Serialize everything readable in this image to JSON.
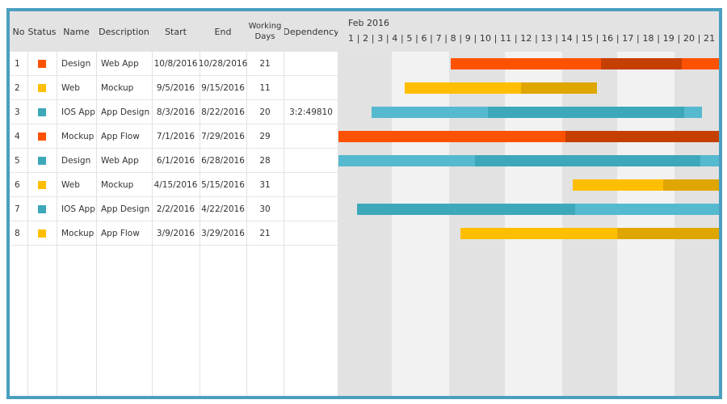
{
  "columns": {
    "no": "No",
    "status": "Status",
    "name": "Name",
    "description": "Description",
    "start": "Start",
    "end": "End",
    "working_days": "Working Days",
    "dependency": "Dependency"
  },
  "timeline": {
    "month": "Feb 2016",
    "days": "1 | 2 | 3 | 4 | 5 | 6 | 7 | 8 | 9 | 10 | 11 | 12 | 13 | 14 | 15 | 16 | 17 | 18 | 19 | 20 | 21"
  },
  "colors": {
    "orange": "#fe5200",
    "orange_dark": "#c53f00",
    "yellow": "#ffbf00",
    "yellow_dark": "#dfa600",
    "teal": "#3da8ba",
    "teal_light": "#55b9cf",
    "band_dark": "#e2e2e2",
    "band_light": "#f2f2f2",
    "frame": "#4a9fbf"
  },
  "rows": [
    {
      "no": "1",
      "status": "orange",
      "name": "Design",
      "description": "Web App",
      "start": "10/8/2016",
      "end": "10/28/2016",
      "working_days": "21",
      "dependency": ""
    },
    {
      "no": "2",
      "status": "yellow",
      "name": "Web",
      "description": "Mockup",
      "start": "9/5/2016",
      "end": "9/15/2016",
      "working_days": "11",
      "dependency": ""
    },
    {
      "no": "3",
      "status": "teal",
      "name": "IOS App",
      "description": "App Design",
      "start": "8/3/2016",
      "end": "8/22/2016",
      "working_days": "20",
      "dependency": "3:2:49810"
    },
    {
      "no": "4",
      "status": "orange",
      "name": "Mockup",
      "description": "App Flow",
      "start": "7/1/2016",
      "end": "7/29/2016",
      "working_days": "29",
      "dependency": ""
    },
    {
      "no": "5",
      "status": "teal",
      "name": "Design",
      "description": "Web App",
      "start": "6/1/2016",
      "end": "6/28/2016",
      "working_days": "28",
      "dependency": ""
    },
    {
      "no": "6",
      "status": "yellow",
      "name": "Web",
      "description": "Mockup",
      "start": "4/15/2016",
      "end": "5/15/2016",
      "working_days": "31",
      "dependency": ""
    },
    {
      "no": "7",
      "status": "teal",
      "name": "IOS App",
      "description": "App Design",
      "start": "2/2/2016",
      "end": "4/22/2016",
      "working_days": "30",
      "dependency": ""
    },
    {
      "no": "8",
      "status": "yellow",
      "name": "Mockup",
      "description": "App Flow",
      "start": "3/9/2016",
      "end": "3/29/2016",
      "working_days": "21",
      "dependency": ""
    }
  ],
  "chart_data": {
    "type": "gantt",
    "x_axis": {
      "label": "Feb 2016",
      "range": [
        1,
        21.6
      ],
      "ticks": [
        1,
        2,
        3,
        4,
        5,
        6,
        7,
        8,
        9,
        10,
        11,
        12,
        13,
        14,
        15,
        16,
        17,
        18,
        19,
        20,
        21
      ]
    },
    "tasks": [
      {
        "row": 1,
        "segments": [
          {
            "start": 7.1,
            "end": 15.2,
            "color": "orange"
          },
          {
            "start": 15.2,
            "end": 19.6,
            "color": "orange_dark"
          },
          {
            "start": 19.6,
            "end": 21.6,
            "color": "orange"
          }
        ]
      },
      {
        "row": 2,
        "segments": [
          {
            "start": 4.6,
            "end": 10.9,
            "color": "yellow"
          },
          {
            "start": 10.9,
            "end": 15.0,
            "color": "yellow_dark"
          }
        ]
      },
      {
        "row": 3,
        "segments": [
          {
            "start": 2.8,
            "end": 9.1,
            "color": "teal_light"
          },
          {
            "start": 9.1,
            "end": 19.7,
            "color": "teal"
          },
          {
            "start": 19.7,
            "end": 20.7,
            "color": "teal_light"
          }
        ]
      },
      {
        "row": 4,
        "segments": [
          {
            "start": 1.0,
            "end": 13.3,
            "color": "orange"
          },
          {
            "start": 13.3,
            "end": 21.6,
            "color": "orange_dark"
          }
        ]
      },
      {
        "row": 5,
        "segments": [
          {
            "start": 1.0,
            "end": 8.4,
            "color": "teal_light"
          },
          {
            "start": 8.4,
            "end": 20.6,
            "color": "teal"
          },
          {
            "start": 20.6,
            "end": 21.6,
            "color": "teal_light"
          }
        ]
      },
      {
        "row": 6,
        "segments": [
          {
            "start": 13.7,
            "end": 18.6,
            "color": "yellow"
          },
          {
            "start": 18.6,
            "end": 21.6,
            "color": "yellow_dark"
          }
        ]
      },
      {
        "row": 7,
        "segments": [
          {
            "start": 2.0,
            "end": 13.8,
            "color": "teal"
          },
          {
            "start": 13.8,
            "end": 21.6,
            "color": "teal_light"
          }
        ]
      },
      {
        "row": 8,
        "segments": [
          {
            "start": 7.6,
            "end": 16.1,
            "color": "yellow"
          },
          {
            "start": 16.1,
            "end": 21.6,
            "color": "yellow_dark"
          }
        ]
      }
    ],
    "shaded_day_ranges": [
      [
        1,
        3.9,
        "band_dark"
      ],
      [
        3.9,
        7.0,
        "band_light"
      ],
      [
        7.0,
        10.0,
        "band_dark"
      ],
      [
        10.0,
        13.1,
        "band_light"
      ],
      [
        13.1,
        16.1,
        "band_dark"
      ],
      [
        16.1,
        19.2,
        "band_light"
      ],
      [
        19.2,
        21.6,
        "band_dark"
      ]
    ]
  }
}
